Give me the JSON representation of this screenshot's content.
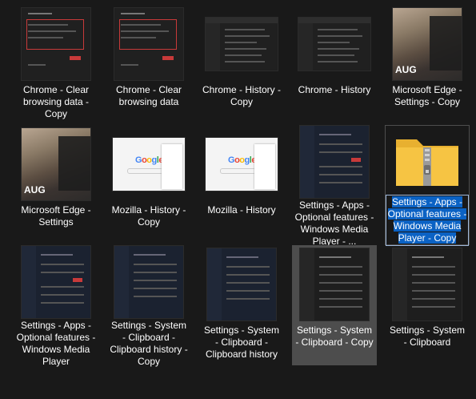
{
  "items": [
    {
      "label": "Chrome - Clear browsing data - Copy"
    },
    {
      "label": "Chrome - Clear browsing data"
    },
    {
      "label": "Chrome - History - Copy"
    },
    {
      "label": "Chrome - History"
    },
    {
      "label": "Microsoft Edge - Settings - Copy",
      "photo_text": "AUG"
    },
    {
      "label": "Microsoft Edge - Settings",
      "photo_text": "AUG"
    },
    {
      "label": "Mozilla - History - Copy",
      "logo": "Google"
    },
    {
      "label": "Mozilla - History",
      "logo": "Google"
    },
    {
      "label": "Settings - Apps - Optional features - Windows Media Player - ..."
    },
    {
      "label": "Settings - Apps - Optional features - Windows Media Player - Copy"
    },
    {
      "label": "Settings - Apps - Optional features - Windows Media Player"
    },
    {
      "label": "Settings - System - Clipboard - Clipboard history - Copy"
    },
    {
      "label": "Settings - System - Clipboard - Clipboard history"
    },
    {
      "label": "Settings - System - Clipboard - Copy"
    },
    {
      "label": "Settings - System - Clipboard"
    }
  ],
  "colors": {
    "background": "#191919",
    "selection": "#0b62c4",
    "hover": "#4d4d4d",
    "folder": "#f6c443"
  }
}
